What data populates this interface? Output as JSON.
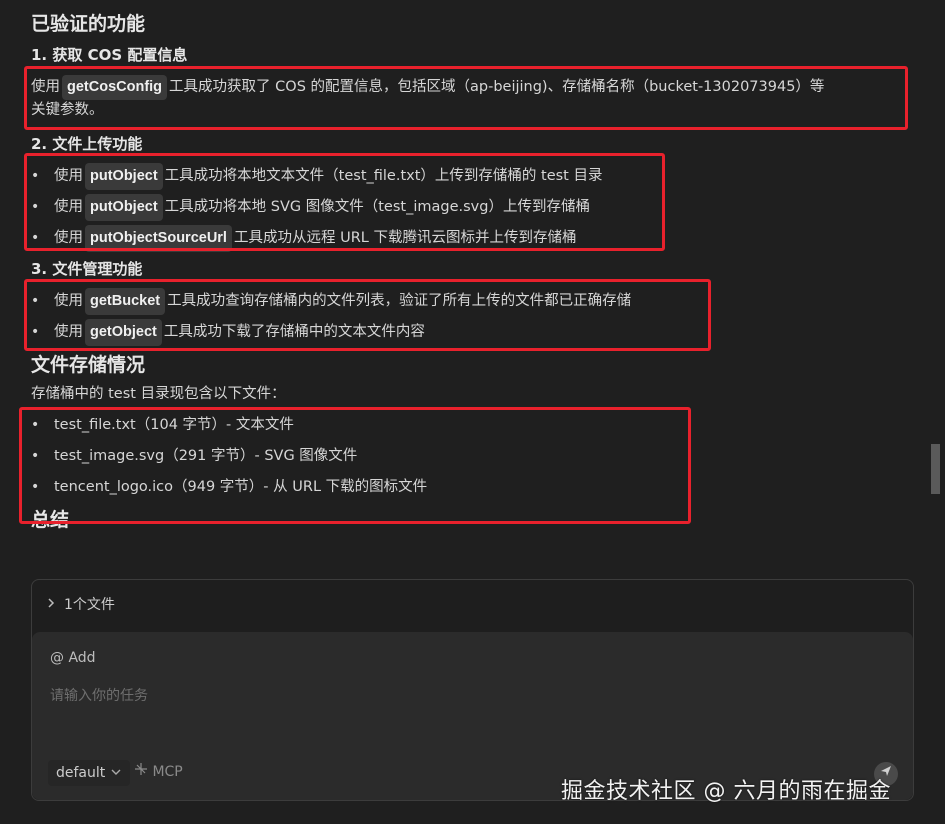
{
  "content": {
    "title_verified": "已验证的功能",
    "sections": [
      {
        "heading": "1. 获取 COS 配置信息",
        "para": {
          "pre": "使用",
          "code": "getCosConfig",
          "post_line1": "工具成功获取了 COS 的配置信息，包括区域（ap-beijing)、存储桶名称（bucket-1302073945）等",
          "post_line2": "关键参数。"
        }
      },
      {
        "heading": "2. 文件上传功能",
        "items": [
          {
            "pre": "使用",
            "code": "putObject",
            "post": "工具成功将本地文本文件（test_file.txt）上传到存储桶的 test 目录"
          },
          {
            "pre": "使用",
            "code": "putObject",
            "post": "工具成功将本地 SVG 图像文件（test_image.svg）上传到存储桶"
          },
          {
            "pre": "使用",
            "code": "putObjectSourceUrl",
            "post": "工具成功从远程 URL 下载腾讯云图标并上传到存储桶"
          }
        ]
      },
      {
        "heading": "3. 文件管理功能",
        "items": [
          {
            "pre": "使用",
            "code": "getBucket",
            "post": "工具成功查询存储桶内的文件列表，验证了所有上传的文件都已正确存储"
          },
          {
            "pre": "使用",
            "code": "getObject",
            "post": "工具成功下载了存储桶中的文本文件内容"
          }
        ]
      }
    ],
    "storage_title": "文件存储情况",
    "storage_intro": "存储桶中的 test 目录现包含以下文件：",
    "files": [
      "test_file.txt（104 字节）- 文本文件",
      "test_image.svg（291 字节）- SVG 图像文件",
      "tencent_logo.ico（949 字节）- 从 URL 下载的图标文件"
    ],
    "summary_title": "总结",
    "bullet_char": "•"
  },
  "panel": {
    "files_label": "1个文件",
    "add_label": "@ Add",
    "input_placeholder": "请输入你的任务",
    "model_select": "default",
    "mcp_label": "MCP"
  },
  "watermark": "掘金技术社区 @ 六月的雨在掘金",
  "colors": {
    "highlight_border": "#e8212c",
    "background": "#1f1f1f",
    "code_bg": "#3a3a3a"
  },
  "icons": {
    "chevron": "chevron-right-icon",
    "select_chevron": "chevron-down-icon",
    "mcp": "mcp-icon",
    "send": "send-icon"
  }
}
